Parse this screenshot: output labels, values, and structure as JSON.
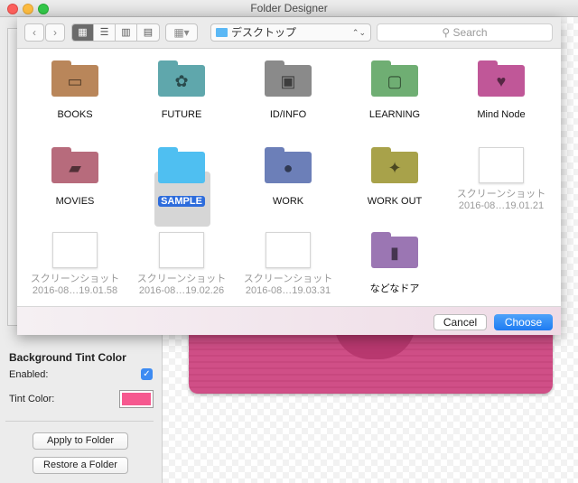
{
  "window": {
    "title": "Folder Designer"
  },
  "tint": {
    "section_title": "Background Tint Color",
    "enabled_label": "Enabled:",
    "enabled": true,
    "tint_label": "Tint Color:",
    "tint_color": "#f6588f"
  },
  "actions": {
    "apply": "Apply to Folder",
    "restore": "Restore a Folder"
  },
  "dialog": {
    "location": "デスクトップ",
    "search_placeholder": "Search",
    "cancel": "Cancel",
    "choose": "Choose",
    "items": [
      {
        "name": "BOOKS",
        "kind": "folder",
        "color": "#b9865a",
        "icon": "open-folder-icon"
      },
      {
        "name": "FUTURE",
        "kind": "folder",
        "color": "#5fa7ac",
        "icon": "plant-icon"
      },
      {
        "name": "ID/INFO",
        "kind": "folder",
        "color": "#8a8a8a",
        "icon": "id-card-icon"
      },
      {
        "name": "LEARNING",
        "kind": "folder",
        "color": "#6fae73",
        "icon": "blackboard-icon"
      },
      {
        "name": "Mind Node",
        "kind": "folder",
        "color": "#c05798",
        "icon": "heart-icon"
      },
      {
        "name": "MOVIES",
        "kind": "folder",
        "color": "#b76b7c",
        "icon": "clapper-icon"
      },
      {
        "name": "SAMPLE",
        "kind": "folder",
        "color": "#4fbff1",
        "icon": "",
        "selected": true
      },
      {
        "name": "WORK",
        "kind": "folder",
        "color": "#6c7fb8",
        "icon": "globe-icon"
      },
      {
        "name": "WORK OUT",
        "kind": "folder",
        "color": "#a8a24a",
        "icon": "runner-icon"
      },
      {
        "name": "スクリーンショット",
        "date": "2016-08…19.01.21",
        "kind": "screenshot"
      },
      {
        "name": "スクリーンショット",
        "date": "2016-08…19.01.58",
        "kind": "screenshot"
      },
      {
        "name": "スクリーンショット",
        "date": "2016-08…19.02.26",
        "kind": "screenshot"
      },
      {
        "name": "スクリーンショット",
        "date": "2016-08…19.03.31",
        "kind": "screenshot"
      },
      {
        "name": "などなドア",
        "kind": "folder",
        "color": "#9b76b3",
        "icon": "door-icon"
      }
    ]
  }
}
